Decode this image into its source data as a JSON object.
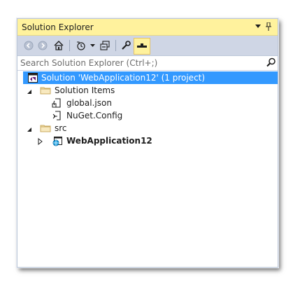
{
  "panel": {
    "title": "Solution Explorer",
    "pin_glyph": "▾",
    "dock_glyph": "↧"
  },
  "toolbar": {
    "icons": [
      "back-icon",
      "forward-icon",
      "home-icon",
      "history-icon",
      "dropdown-icon",
      "collapse-all-icon",
      "properties-wrench-icon",
      "preview-icon"
    ]
  },
  "search": {
    "placeholder": "Search Solution Explorer (Ctrl+;)"
  },
  "tree": {
    "solution": "Solution 'WebApplication12' (1 project)",
    "solution_items": "Solution Items",
    "global_json": "global.json",
    "nuget_config": "NuGet.Config",
    "src": "src",
    "project": "WebApplication12"
  },
  "colors": {
    "title_bg": "#fff29d",
    "toolbar_bg": "#cfd6e5",
    "selection": "#3399ff"
  }
}
